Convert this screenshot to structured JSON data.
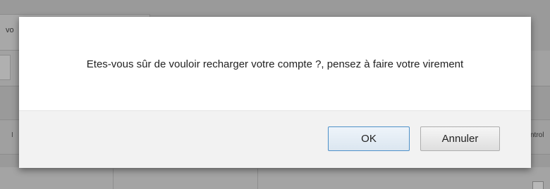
{
  "background": {
    "tab_label": "vo",
    "left_mark": "I",
    "column_header": "ntrol"
  },
  "dialog": {
    "message": "Etes-vous sûr de vouloir recharger votre compte ?, pensez à faire votre virement",
    "ok_label": "OK",
    "cancel_label": "Annuler"
  },
  "colors": {
    "overlay": "#9a9a9a",
    "dialog_body": "#ffffff",
    "dialog_footer": "#f2f2f2",
    "ok_border": "#4d90c8"
  }
}
